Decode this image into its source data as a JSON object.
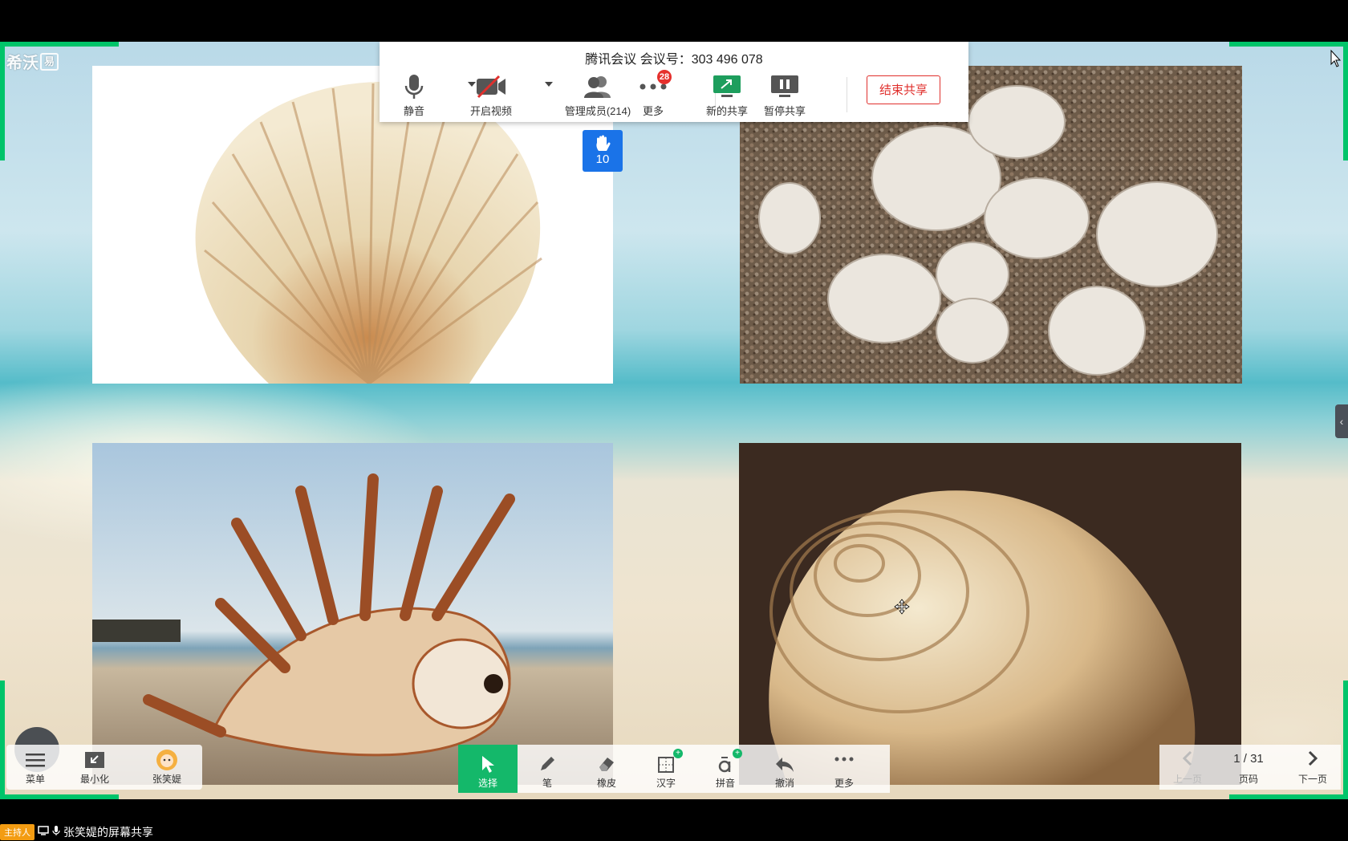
{
  "logo": {
    "text": "希沃",
    "box": "易"
  },
  "meeting": {
    "title": "腾讯会议 会议号：303 496 078",
    "buttons": {
      "mute": "静音",
      "video": "开启视频",
      "members": "管理成员(214)",
      "more": "更多",
      "more_badge": "28",
      "new_share": "新的共享",
      "pause_share": "暂停共享",
      "end_share": "结束共享"
    },
    "raised_hands": "10"
  },
  "left_panel": {
    "menu": "菜单",
    "minimize": "最小化",
    "user": "张笑媞"
  },
  "tools": {
    "select": "选择",
    "pen": "笔",
    "eraser": "橡皮",
    "hanzi": "汉字",
    "pinyin": "拼音",
    "undo": "撤消",
    "more": "更多"
  },
  "pager": {
    "prev": "上一页",
    "page": "1 / 31",
    "page_label": "页码",
    "next": "下一页"
  },
  "status": {
    "host_tag": "主持人",
    "sharing": "张笑媞的屏幕共享"
  },
  "colors": {
    "accent_green": "#14b86a",
    "end_red": "#e0302d",
    "hand_blue": "#1a73e8"
  }
}
